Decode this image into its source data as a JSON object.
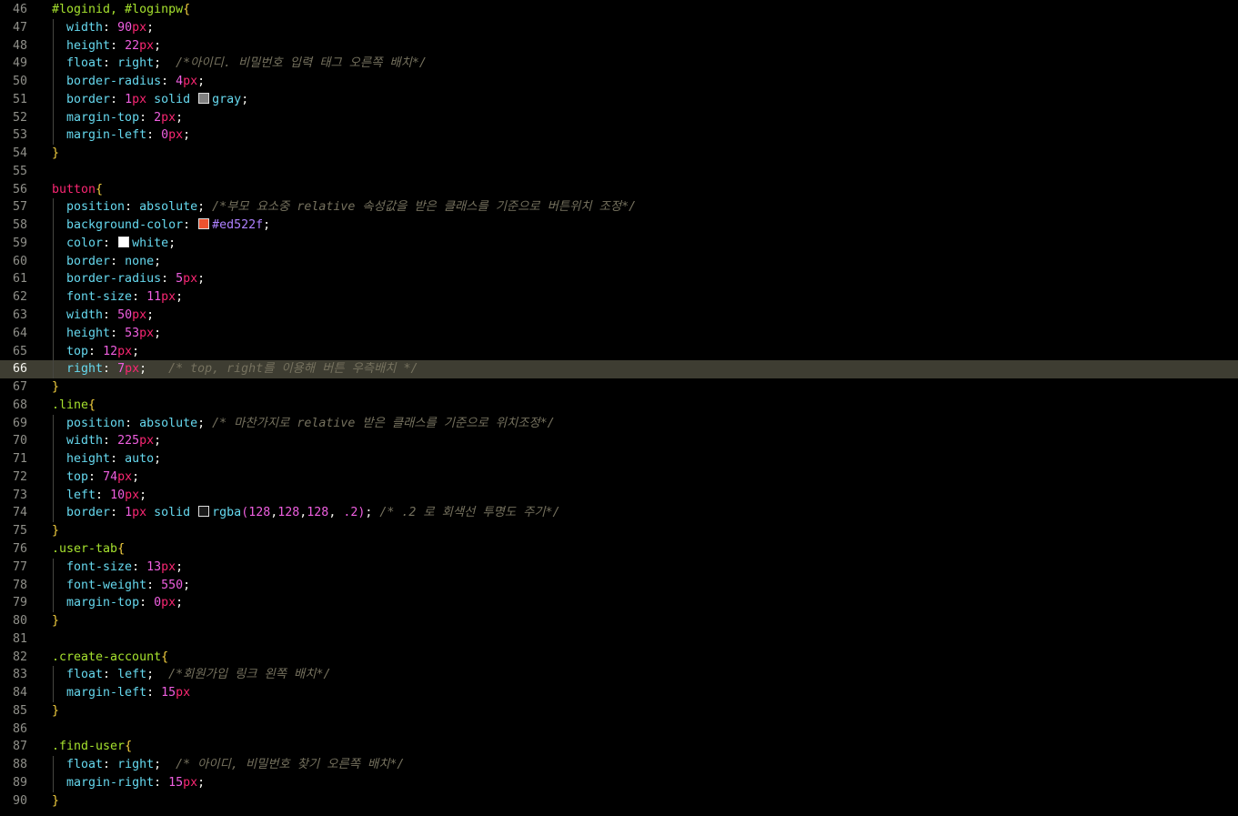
{
  "active_line": 66,
  "lines": [
    {
      "n": "46",
      "tokens": [
        [
          "sel",
          "#loginid, #loginpw"
        ],
        [
          "brace",
          "{"
        ]
      ]
    },
    {
      "n": "47",
      "g": 1,
      "tokens": [
        [
          "punc",
          "  "
        ],
        [
          "prop",
          "width"
        ],
        [
          "punc",
          ": "
        ],
        [
          "num",
          "90"
        ],
        [
          "unit",
          "px"
        ],
        [
          "punc",
          ";"
        ]
      ]
    },
    {
      "n": "48",
      "g": 1,
      "tokens": [
        [
          "punc",
          "  "
        ],
        [
          "prop",
          "height"
        ],
        [
          "punc",
          ": "
        ],
        [
          "num",
          "22"
        ],
        [
          "unit",
          "px"
        ],
        [
          "punc",
          ";"
        ]
      ]
    },
    {
      "n": "49",
      "g": 1,
      "tokens": [
        [
          "punc",
          "  "
        ],
        [
          "prop",
          "float"
        ],
        [
          "punc",
          ": "
        ],
        [
          "val",
          "right"
        ],
        [
          "punc",
          ";  "
        ],
        [
          "com",
          "/*아이디. 비밀번호 입력 태그 오른쪽 배치*/"
        ]
      ]
    },
    {
      "n": "50",
      "g": 1,
      "tokens": [
        [
          "punc",
          "  "
        ],
        [
          "prop",
          "border-radius"
        ],
        [
          "punc",
          ": "
        ],
        [
          "num",
          "4"
        ],
        [
          "unit",
          "px"
        ],
        [
          "punc",
          ";"
        ]
      ]
    },
    {
      "n": "51",
      "g": 1,
      "tokens": [
        [
          "punc",
          "  "
        ],
        [
          "prop",
          "border"
        ],
        [
          "punc",
          ": "
        ],
        [
          "num",
          "1"
        ],
        [
          "unit",
          "px"
        ],
        [
          "val",
          " solid "
        ],
        [
          "swatch",
          "#808080"
        ],
        [
          "val",
          "gray"
        ],
        [
          "punc",
          ";"
        ]
      ]
    },
    {
      "n": "52",
      "g": 1,
      "tokens": [
        [
          "punc",
          "  "
        ],
        [
          "prop",
          "margin-top"
        ],
        [
          "punc",
          ": "
        ],
        [
          "num",
          "2"
        ],
        [
          "unit",
          "px"
        ],
        [
          "punc",
          ";"
        ]
      ]
    },
    {
      "n": "53",
      "g": 1,
      "tokens": [
        [
          "punc",
          "  "
        ],
        [
          "prop",
          "margin-left"
        ],
        [
          "punc",
          ": "
        ],
        [
          "num",
          "0"
        ],
        [
          "unit",
          "px"
        ],
        [
          "punc",
          ";"
        ]
      ]
    },
    {
      "n": "54",
      "tokens": [
        [
          "brace",
          "}"
        ]
      ]
    },
    {
      "n": "55",
      "tokens": []
    },
    {
      "n": "56",
      "tokens": [
        [
          "tag",
          "button"
        ],
        [
          "brace",
          "{"
        ]
      ]
    },
    {
      "n": "57",
      "g": 1,
      "tokens": [
        [
          "punc",
          "  "
        ],
        [
          "prop",
          "position"
        ],
        [
          "punc",
          ": "
        ],
        [
          "val",
          "absolute"
        ],
        [
          "punc",
          "; "
        ],
        [
          "com",
          "/*부모 요소중 relative 속성값을 받은 클래스를 기준으로 버튼위치 조정*/"
        ]
      ]
    },
    {
      "n": "58",
      "g": 1,
      "tokens": [
        [
          "punc",
          "  "
        ],
        [
          "prop",
          "background-color"
        ],
        [
          "punc",
          ": "
        ],
        [
          "swatch",
          "#ed522f"
        ],
        [
          "hex",
          "#ed522f"
        ],
        [
          "punc",
          ";"
        ]
      ]
    },
    {
      "n": "59",
      "g": 1,
      "tokens": [
        [
          "punc",
          "  "
        ],
        [
          "prop",
          "color"
        ],
        [
          "punc",
          ": "
        ],
        [
          "swatch",
          "#ffffff"
        ],
        [
          "val",
          "white"
        ],
        [
          "punc",
          ";"
        ]
      ]
    },
    {
      "n": "60",
      "g": 1,
      "tokens": [
        [
          "punc",
          "  "
        ],
        [
          "prop",
          "border"
        ],
        [
          "punc",
          ": "
        ],
        [
          "val",
          "none"
        ],
        [
          "punc",
          ";"
        ]
      ]
    },
    {
      "n": "61",
      "g": 1,
      "tokens": [
        [
          "punc",
          "  "
        ],
        [
          "prop",
          "border-radius"
        ],
        [
          "punc",
          ": "
        ],
        [
          "num",
          "5"
        ],
        [
          "unit",
          "px"
        ],
        [
          "punc",
          ";"
        ]
      ]
    },
    {
      "n": "62",
      "g": 1,
      "tokens": [
        [
          "punc",
          "  "
        ],
        [
          "prop",
          "font-size"
        ],
        [
          "punc",
          ": "
        ],
        [
          "num",
          "11"
        ],
        [
          "unit",
          "px"
        ],
        [
          "punc",
          ";"
        ]
      ]
    },
    {
      "n": "63",
      "g": 1,
      "tokens": [
        [
          "punc",
          "  "
        ],
        [
          "prop",
          "width"
        ],
        [
          "punc",
          ": "
        ],
        [
          "num",
          "50"
        ],
        [
          "unit",
          "px"
        ],
        [
          "punc",
          ";"
        ]
      ]
    },
    {
      "n": "64",
      "g": 1,
      "tokens": [
        [
          "punc",
          "  "
        ],
        [
          "prop",
          "height"
        ],
        [
          "punc",
          ": "
        ],
        [
          "num",
          "53"
        ],
        [
          "unit",
          "px"
        ],
        [
          "punc",
          ";"
        ]
      ]
    },
    {
      "n": "65",
      "g": 1,
      "tokens": [
        [
          "punc",
          "  "
        ],
        [
          "prop",
          "top"
        ],
        [
          "punc",
          ": "
        ],
        [
          "num",
          "12"
        ],
        [
          "unit",
          "px"
        ],
        [
          "punc",
          ";"
        ]
      ]
    },
    {
      "n": "66",
      "g": 1,
      "tokens": [
        [
          "punc",
          "  "
        ],
        [
          "prop",
          "right"
        ],
        [
          "punc",
          ": "
        ],
        [
          "num",
          "7"
        ],
        [
          "unit",
          "px"
        ],
        [
          "punc",
          ";   "
        ],
        [
          "com",
          "/* top, right를 이용해 버튼 우측배치 */"
        ]
      ]
    },
    {
      "n": "67",
      "tokens": [
        [
          "brace",
          "}"
        ]
      ]
    },
    {
      "n": "68",
      "tokens": [
        [
          "sel",
          ".line"
        ],
        [
          "brace",
          "{"
        ]
      ]
    },
    {
      "n": "69",
      "g": 1,
      "tokens": [
        [
          "punc",
          "  "
        ],
        [
          "prop",
          "position"
        ],
        [
          "punc",
          ": "
        ],
        [
          "val",
          "absolute"
        ],
        [
          "punc",
          "; "
        ],
        [
          "com",
          "/* 마찬가지로 relative 받은 클래스를 기준으로 위치조정*/"
        ]
      ]
    },
    {
      "n": "70",
      "g": 1,
      "tokens": [
        [
          "punc",
          "  "
        ],
        [
          "prop",
          "width"
        ],
        [
          "punc",
          ": "
        ],
        [
          "num",
          "225"
        ],
        [
          "unit",
          "px"
        ],
        [
          "punc",
          ";"
        ]
      ]
    },
    {
      "n": "71",
      "g": 1,
      "tokens": [
        [
          "punc",
          "  "
        ],
        [
          "prop",
          "height"
        ],
        [
          "punc",
          ": "
        ],
        [
          "val",
          "auto"
        ],
        [
          "punc",
          ";"
        ]
      ]
    },
    {
      "n": "72",
      "g": 1,
      "tokens": [
        [
          "punc",
          "  "
        ],
        [
          "prop",
          "top"
        ],
        [
          "punc",
          ": "
        ],
        [
          "num",
          "74"
        ],
        [
          "unit",
          "px"
        ],
        [
          "punc",
          ";"
        ]
      ]
    },
    {
      "n": "73",
      "g": 1,
      "tokens": [
        [
          "punc",
          "  "
        ],
        [
          "prop",
          "left"
        ],
        [
          "punc",
          ": "
        ],
        [
          "num",
          "10"
        ],
        [
          "unit",
          "px"
        ],
        [
          "punc",
          ";"
        ]
      ]
    },
    {
      "n": "74",
      "g": 1,
      "tokens": [
        [
          "punc",
          "  "
        ],
        [
          "prop",
          "border"
        ],
        [
          "punc",
          ": "
        ],
        [
          "num",
          "1"
        ],
        [
          "unit",
          "px"
        ],
        [
          "val",
          " solid "
        ],
        [
          "swatch",
          "rgba(128,128,128,.2)"
        ],
        [
          "val",
          "rgba"
        ],
        [
          "paren",
          "("
        ],
        [
          "num",
          "128"
        ],
        [
          "punc",
          ","
        ],
        [
          "num",
          "128"
        ],
        [
          "punc",
          ","
        ],
        [
          "num",
          "128"
        ],
        [
          "punc",
          ", "
        ],
        [
          "num",
          ".2"
        ],
        [
          "paren",
          ")"
        ],
        [
          "punc",
          "; "
        ],
        [
          "com",
          "/* .2 로 회색선 투명도 주기*/"
        ]
      ]
    },
    {
      "n": "75",
      "tokens": [
        [
          "brace",
          "}"
        ]
      ]
    },
    {
      "n": "76",
      "tokens": [
        [
          "sel",
          ".user-tab"
        ],
        [
          "brace",
          "{"
        ]
      ]
    },
    {
      "n": "77",
      "g": 1,
      "tokens": [
        [
          "punc",
          "  "
        ],
        [
          "prop",
          "font-size"
        ],
        [
          "punc",
          ": "
        ],
        [
          "num",
          "13"
        ],
        [
          "unit",
          "px"
        ],
        [
          "punc",
          ";"
        ]
      ]
    },
    {
      "n": "78",
      "g": 1,
      "tokens": [
        [
          "punc",
          "  "
        ],
        [
          "prop",
          "font-weight"
        ],
        [
          "punc",
          ": "
        ],
        [
          "num",
          "550"
        ],
        [
          "punc",
          ";"
        ]
      ]
    },
    {
      "n": "79",
      "g": 1,
      "tokens": [
        [
          "punc",
          "  "
        ],
        [
          "prop",
          "margin-top"
        ],
        [
          "punc",
          ": "
        ],
        [
          "num",
          "0"
        ],
        [
          "unit",
          "px"
        ],
        [
          "punc",
          ";"
        ]
      ]
    },
    {
      "n": "80",
      "tokens": [
        [
          "brace",
          "}"
        ]
      ]
    },
    {
      "n": "81",
      "tokens": []
    },
    {
      "n": "82",
      "tokens": [
        [
          "sel",
          ".create-account"
        ],
        [
          "brace",
          "{"
        ]
      ]
    },
    {
      "n": "83",
      "g": 1,
      "tokens": [
        [
          "punc",
          "  "
        ],
        [
          "prop",
          "float"
        ],
        [
          "punc",
          ": "
        ],
        [
          "val",
          "left"
        ],
        [
          "punc",
          ";  "
        ],
        [
          "com",
          "/*회원가입 링크 왼쪽 배치*/"
        ]
      ]
    },
    {
      "n": "84",
      "g": 1,
      "tokens": [
        [
          "punc",
          "  "
        ],
        [
          "prop",
          "margin-left"
        ],
        [
          "punc",
          ": "
        ],
        [
          "num",
          "15"
        ],
        [
          "unit",
          "px"
        ]
      ]
    },
    {
      "n": "85",
      "tokens": [
        [
          "brace",
          "}"
        ]
      ]
    },
    {
      "n": "86",
      "tokens": []
    },
    {
      "n": "87",
      "tokens": [
        [
          "sel",
          ".find-user"
        ],
        [
          "brace",
          "{"
        ]
      ]
    },
    {
      "n": "88",
      "g": 1,
      "tokens": [
        [
          "punc",
          "  "
        ],
        [
          "prop",
          "float"
        ],
        [
          "punc",
          ": "
        ],
        [
          "val",
          "right"
        ],
        [
          "punc",
          ";  "
        ],
        [
          "com",
          "/* 아이디, 비밀번호 찾기 오른쪽 배치*/"
        ]
      ]
    },
    {
      "n": "89",
      "g": 1,
      "tokens": [
        [
          "punc",
          "  "
        ],
        [
          "prop",
          "margin-right"
        ],
        [
          "punc",
          ": "
        ],
        [
          "num",
          "15"
        ],
        [
          "unit",
          "px"
        ],
        [
          "punc",
          ";"
        ]
      ]
    },
    {
      "n": "90",
      "tokens": [
        [
          "brace",
          "}"
        ]
      ]
    }
  ]
}
